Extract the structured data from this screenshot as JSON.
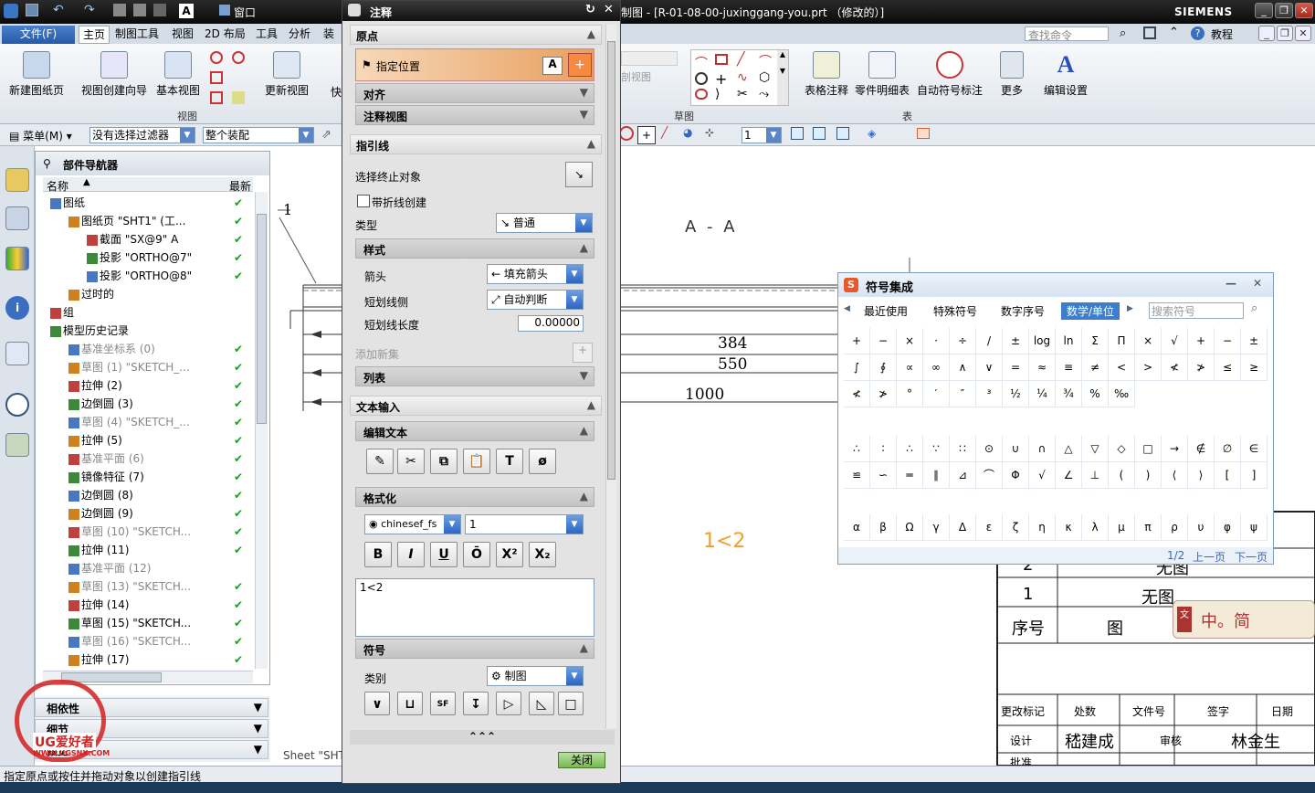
{
  "window": {
    "title": "制图 - [R-01-08-00-juxinggang-you.prt （修改的）]",
    "brand": "SIEMENS",
    "search_placeholder": "查找命令",
    "help_label": "教程"
  },
  "quick_access": {
    "window_menu": "窗口"
  },
  "ribbon_tabs": [
    "文件(F)",
    "主页",
    "制图工具",
    "视图",
    "2D 布局",
    "工具",
    "分析",
    "装"
  ],
  "ribbon": {
    "buttons": [
      "新建图纸页",
      "视图创建向导",
      "基本视图",
      "更新视图",
      "表格注释",
      "零件明细表",
      "自动符号标注",
      "更多",
      "编辑设置",
      "快"
    ],
    "groups": [
      "视图",
      "草图",
      "表"
    ],
    "partial_label": "剖视图"
  },
  "filter_bar": {
    "menu_label": "菜单(M)",
    "filter_value": "没有选择过滤器",
    "assembly_value": "整个装配",
    "spinner_value": "1"
  },
  "navigator": {
    "title": "部件导航器",
    "col_name": "名称",
    "col_latest": "最新",
    "rows": [
      {
        "label": "图纸",
        "indent": 0,
        "gray": false,
        "check": true
      },
      {
        "label": "图纸页 \"SHT1\" (工...",
        "indent": 1,
        "gray": false,
        "check": true
      },
      {
        "label": "截面 \"SX@9\" A",
        "indent": 2,
        "gray": false,
        "check": true
      },
      {
        "label": "投影 \"ORTHO@7\"",
        "indent": 2,
        "gray": false,
        "check": true
      },
      {
        "label": "投影 \"ORTHO@8\"",
        "indent": 2,
        "gray": false,
        "check": true
      },
      {
        "label": "过时的",
        "indent": 1,
        "gray": false,
        "check": false
      },
      {
        "label": "组",
        "indent": 0,
        "gray": false,
        "check": false
      },
      {
        "label": "模型历史记录",
        "indent": 0,
        "gray": false,
        "check": false
      },
      {
        "label": "基准坐标系 (0)",
        "indent": 1,
        "gray": true,
        "check": true
      },
      {
        "label": "草图 (1) \"SKETCH_...",
        "indent": 1,
        "gray": true,
        "check": true
      },
      {
        "label": "拉伸 (2)",
        "indent": 1,
        "gray": false,
        "check": true
      },
      {
        "label": "边倒圆 (3)",
        "indent": 1,
        "gray": false,
        "check": true
      },
      {
        "label": "草图 (4) \"SKETCH_...",
        "indent": 1,
        "gray": true,
        "check": true
      },
      {
        "label": "拉伸 (5)",
        "indent": 1,
        "gray": false,
        "check": true
      },
      {
        "label": "基准平面 (6)",
        "indent": 1,
        "gray": true,
        "check": true
      },
      {
        "label": "镜像特征 (7)",
        "indent": 1,
        "gray": false,
        "check": true
      },
      {
        "label": "边倒圆 (8)",
        "indent": 1,
        "gray": false,
        "check": true
      },
      {
        "label": "边倒圆 (9)",
        "indent": 1,
        "gray": false,
        "check": true
      },
      {
        "label": "草图 (10) \"SKETCH...",
        "indent": 1,
        "gray": true,
        "check": true
      },
      {
        "label": "拉伸 (11)",
        "indent": 1,
        "gray": false,
        "check": true
      },
      {
        "label": "基准平面 (12)",
        "indent": 1,
        "gray": true,
        "check": false
      },
      {
        "label": "草图 (13) \"SKETCH...",
        "indent": 1,
        "gray": true,
        "check": true
      },
      {
        "label": "拉伸 (14)",
        "indent": 1,
        "gray": false,
        "check": true
      },
      {
        "label": "草图 (15) \"SKETCH...",
        "indent": 1,
        "gray": false,
        "check": true
      },
      {
        "label": "草图 (16) \"SKETCH...",
        "indent": 1,
        "gray": true,
        "check": true
      },
      {
        "label": "拉伸 (17)",
        "indent": 1,
        "gray": false,
        "check": true
      }
    ],
    "bottom_panels": [
      "相依性",
      "细节",
      "预览"
    ]
  },
  "annotation_dialog": {
    "title": "注释",
    "origin_section": "原点",
    "specify_location": "指定位置",
    "align_label": "对齐",
    "annotation_view_label": "注释视图",
    "leader_section": "指引线",
    "select_terminating": "选择终止对象",
    "with_jog": "带折线创建",
    "type_label": "类型",
    "type_value": "普通",
    "style_label": "样式",
    "arrow_label": "箭头",
    "arrow_value": "填充箭头",
    "stub_side_label": "短划线侧",
    "stub_side_value": "自动判断",
    "stub_length_label": "短划线长度",
    "stub_length_value": "0.00000",
    "add_new_set": "添加新集",
    "list_label": "列表",
    "text_input_section": "文本输入",
    "edit_text_label": "编辑文本",
    "format_label": "格式化",
    "font_value": "chinesef_fs",
    "size_value": "1",
    "format_buttons": [
      "B",
      "I",
      "U",
      "Ō",
      "X²",
      "X₂"
    ],
    "text_content": "1<2",
    "symbols_label": "符号",
    "category_label": "类别",
    "category_value": "制图",
    "close_button": "关闭"
  },
  "symbol_panel": {
    "title": "符号集成",
    "tabs": [
      "最近使用",
      "特殊符号",
      "数字序号",
      "数学/单位"
    ],
    "search_placeholder": "搜索符号",
    "rows_a": [
      [
        "+",
        "−",
        "×",
        "·",
        "÷",
        "/",
        "±",
        "log",
        "ln",
        "Σ",
        "Π",
        "×",
        "√",
        "+",
        "−",
        "±"
      ],
      [
        "∫",
        "∮",
        "∝",
        "∞",
        "∧",
        "∨",
        "=",
        "≈",
        "≡",
        "≠",
        "<",
        ">",
        "≮",
        "≯",
        "≤",
        "≥"
      ],
      [
        "≮",
        "≯",
        "°",
        "′",
        "″",
        "³",
        "½",
        "¼",
        "¾",
        "%",
        "‰"
      ]
    ],
    "rows_b": [
      [
        "∴",
        "∶",
        "∴",
        "∵",
        "∷",
        "⊙",
        "∪",
        "∩",
        "△",
        "▽",
        "◇",
        "□",
        "→",
        "∉",
        "∅",
        "∈"
      ],
      [
        "≌",
        "∽",
        "═",
        "∥",
        "⊿",
        "⌒",
        "Φ",
        "√",
        "∠",
        "⊥",
        "(",
        ")",
        "⟨",
        "⟩",
        "[",
        "]"
      ]
    ],
    "rows_c": [
      [
        "α",
        "β",
        "Ω",
        "γ",
        "Δ",
        "ε",
        "ζ",
        "η",
        "κ",
        "λ",
        "μ",
        "π",
        "ρ",
        "υ",
        "φ",
        "ψ"
      ]
    ],
    "page": "1/2",
    "prev": "上一页",
    "next": "下一页"
  },
  "drawing": {
    "view_label": "A - A",
    "dim_384": "384",
    "dim_550": "550",
    "dim_1000": "1000",
    "callout": "1",
    "annotation_preview": "1<2",
    "sheet_label": "Sheet \"SHT",
    "title_block": {
      "row2": "2",
      "row2_val": "无图",
      "row1": "1",
      "row1_val": "无图",
      "seq": "序号",
      "seq_val": "图",
      "hdr1": "更改标记",
      "hdr2": "处数",
      "hdr3": "文件号",
      "hdr4": "签字",
      "hdr5": "日期",
      "design": "设计",
      "designer": "嵇建成",
      "review": "审核",
      "reviewer": "林金生",
      "bottom": "批准"
    }
  },
  "ime": {
    "label": "中。简"
  },
  "watermark": {
    "brand": "UG爱好者",
    "url": "WWW.UGSNX.COM"
  },
  "status": {
    "prompt": "指定原点或按住并拖动对象以创建指引线"
  }
}
